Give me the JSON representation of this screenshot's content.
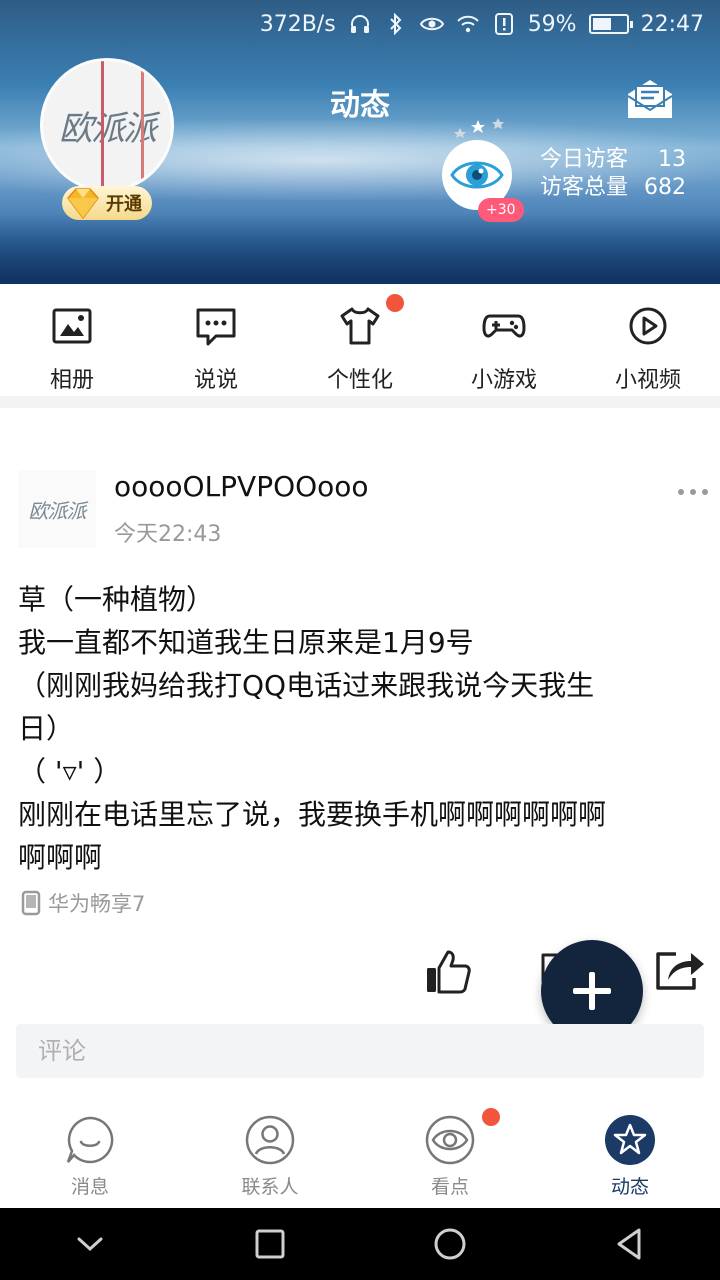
{
  "status_bar": {
    "net_speed": "372B/s",
    "battery_pct": "59%",
    "battery_level": 0.59,
    "time": "22:47",
    "icons": [
      "headphones-icon",
      "bluetooth-icon",
      "eye-icon",
      "wifi-icon",
      "alert-icon"
    ]
  },
  "header": {
    "title": "动态",
    "vip_label": "开通",
    "visitors_badge": "+30",
    "today_visitors_label": "今日访客",
    "today_visitors_value": "13",
    "total_visitors_label": "访客总量",
    "total_visitors_value": "682",
    "avatar_text": "欧派派"
  },
  "quick_nav": {
    "items": [
      {
        "label": "相册",
        "icon": "album-icon"
      },
      {
        "label": "说说",
        "icon": "chat-icon"
      },
      {
        "label": "个性化",
        "icon": "tshirt-icon",
        "dot": true
      },
      {
        "label": "小游戏",
        "icon": "gamepad-icon"
      },
      {
        "label": "小视频",
        "icon": "play-icon"
      }
    ]
  },
  "post": {
    "author": "ooooOLPVPOOooo",
    "avatar_text": "欧派派",
    "time": "今天22:43",
    "lines": [
      "草（一种植物）",
      "我一直都不知道我生日原来是1月9号",
      "（刚刚我妈给我打QQ电话过来跟我说今天我生",
      "日）",
      "（ '▿' ）",
      "刚刚在电话里忘了说，我要换手机啊啊啊啊啊啊",
      "啊啊啊"
    ],
    "device": "华为畅享7",
    "comment_placeholder": "评论"
  },
  "tabs": [
    {
      "label": "消息",
      "icon": "message-smile-icon"
    },
    {
      "label": "联系人",
      "icon": "contacts-icon"
    },
    {
      "label": "看点",
      "icon": "kandian-eye-icon",
      "dot": true
    },
    {
      "label": "动态",
      "icon": "star-icon",
      "active": true
    }
  ],
  "colors": {
    "accent": "#13253d",
    "red_dot": "#f2553b",
    "badge_pink": "#ff5a7a"
  }
}
